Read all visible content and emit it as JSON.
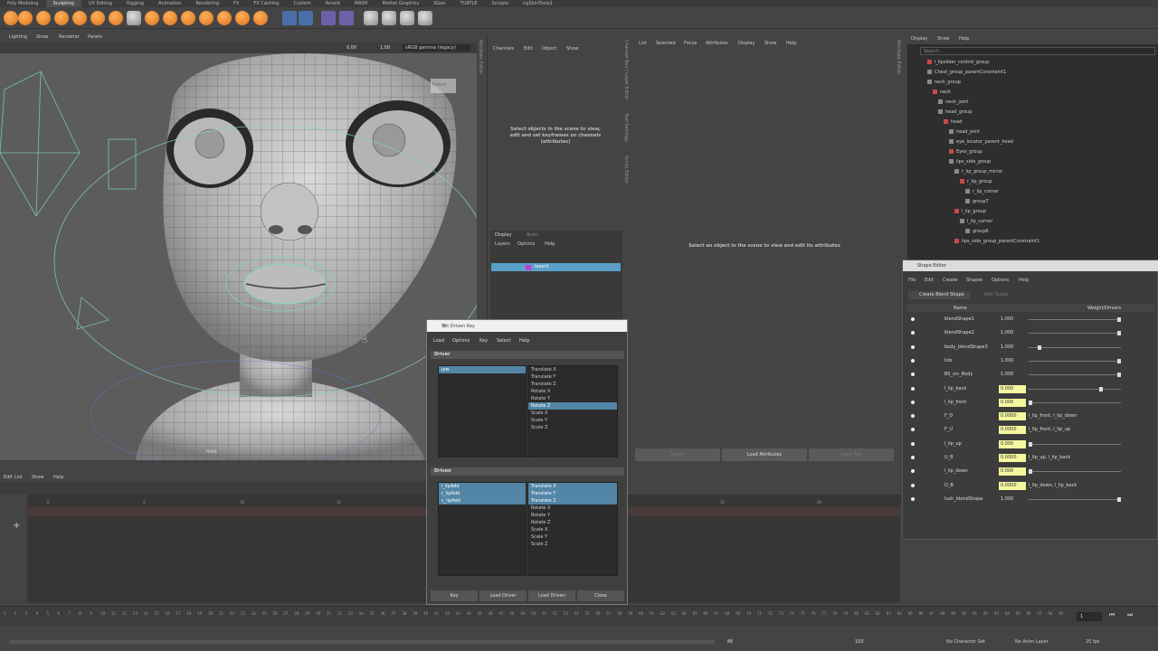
{
  "shelf_tabs": [
    "Poly Modeling",
    "Sculpting",
    "UV Editing",
    "Rigging",
    "Animation",
    "Rendering",
    "FX",
    "FX Caching",
    "Custom",
    "Arnold",
    "MASH",
    "Motion Graphics",
    "XGen",
    "TURTLE",
    "Scrypts",
    "ngSkinTools2"
  ],
  "viewport": {
    "menu": [
      "Lighting",
      "Show",
      "Renderer",
      "Panels"
    ],
    "frame_value": "0.00",
    "scale_value": "1.00",
    "color_space": "sRGB gamma (legacy)",
    "front_label": "front",
    "corner_label": "Femor"
  },
  "channel_box": {
    "menu": [
      "Channels",
      "Edit",
      "Object",
      "Show"
    ],
    "message": "Select objects in the scene to view, edit and set keyframes on channels (attributes)",
    "layer_tabs": [
      "Display",
      "Anim"
    ],
    "layer_menu": [
      "Layers",
      "Options",
      "Help"
    ],
    "layer_name": "layer1",
    "side_labels": [
      "Channel Box / Layer Editor",
      "Tool Settings",
      "Script Editor"
    ]
  },
  "attribute_editor": {
    "menu": [
      "List",
      "Selected",
      "Focus",
      "Attributes",
      "Display",
      "Show",
      "Help"
    ],
    "message": "Select an object in the scene to view and edit its attributes",
    "buttons": [
      "Select",
      "Load Attributes",
      "Copy Tab"
    ],
    "side_label": "Attribute Editor"
  },
  "outliner": {
    "menu": [
      "Display",
      "Show",
      "Help"
    ],
    "search_placeholder": "Search...",
    "items": [
      {
        "label": "l_lipslider_control_group",
        "indent": 2
      },
      {
        "label": "Chest_group_parentConstraint1",
        "indent": 2
      },
      {
        "label": "neck_group",
        "indent": 2
      },
      {
        "label": "neck",
        "indent": 3
      },
      {
        "label": "neck_joint",
        "indent": 4
      },
      {
        "label": "head_group",
        "indent": 4
      },
      {
        "label": "head",
        "indent": 5
      },
      {
        "label": "head_joint",
        "indent": 6
      },
      {
        "label": "eye_locator_parent_head",
        "indent": 6
      },
      {
        "label": "Eyes_group",
        "indent": 6
      },
      {
        "label": "lips_side_group",
        "indent": 6
      },
      {
        "label": "r_lip_group_mirror",
        "indent": 7
      },
      {
        "label": "r_lip_group",
        "indent": 8
      },
      {
        "label": "r_lip_corner",
        "indent": 9
      },
      {
        "label": "group7",
        "indent": 9
      },
      {
        "label": "l_lip_group",
        "indent": 7
      },
      {
        "label": "l_lip_corner",
        "indent": 8
      },
      {
        "label": "group6",
        "indent": 9
      },
      {
        "label": "lips_side_group_parentConstraint1",
        "indent": 7
      }
    ]
  },
  "shape_editor": {
    "title": "Shape Editor",
    "menu": [
      "File",
      "Edit",
      "Create",
      "Shapes",
      "Options",
      "Help"
    ],
    "create_button": "Create Blend Shape",
    "add_target_button": "Add Target",
    "columns": [
      "Name",
      "Weight/Drivers"
    ],
    "rows": [
      {
        "name": "blendShape1",
        "value": "1.000",
        "hl": false,
        "knob": 1.0,
        "drivers": ""
      },
      {
        "name": "blendShape2",
        "value": "1.000",
        "hl": false,
        "knob": 1.0,
        "drivers": ""
      },
      {
        "name": "body_blendShape3",
        "value": "1.000",
        "hl": false,
        "knob": 0.1,
        "drivers": ""
      },
      {
        "name": "lids",
        "value": "1.000",
        "hl": false,
        "knob": 1.0,
        "drivers": ""
      },
      {
        "name": "BS_src_Body",
        "value": "1.000",
        "hl": false,
        "knob": 1.0,
        "drivers": ""
      },
      {
        "name": "l_lip_back",
        "value": "0.000",
        "hl": true,
        "knob": 0.8,
        "drivers": ""
      },
      {
        "name": "l_lip_front",
        "value": "0.000",
        "hl": true,
        "knob": 0.0,
        "drivers": ""
      },
      {
        "name": "F_D",
        "value": "0.0000",
        "hl": true,
        "knob": null,
        "drivers": "l_lip_front, l_lip_down"
      },
      {
        "name": "F_U",
        "value": "0.0000",
        "hl": true,
        "knob": null,
        "drivers": "l_lip_front, l_lip_up"
      },
      {
        "name": "l_lip_up",
        "value": "0.000",
        "hl": true,
        "knob": 0.0,
        "drivers": ""
      },
      {
        "name": "U_B",
        "value": "0.0000",
        "hl": true,
        "knob": null,
        "drivers": "l_lip_up, l_lip_back"
      },
      {
        "name": "l_lip_down",
        "value": "0.000",
        "hl": true,
        "knob": 0.0,
        "drivers": ""
      },
      {
        "name": "D_B",
        "value": "0.0000",
        "hl": true,
        "knob": null,
        "drivers": "l_lip_down, l_lip_back"
      },
      {
        "name": "lush_blendShape",
        "value": "1.000",
        "hl": false,
        "knob": 1.0,
        "drivers": ""
      }
    ]
  },
  "sdk": {
    "title": "Set Driven Key",
    "menu": [
      "Load",
      "Options",
      "Key",
      "Select",
      "Help"
    ],
    "driver_section": "Driver",
    "driven_section": "Driven",
    "driver_objects": [
      "jaw"
    ],
    "driver_attrs": [
      "Translate X",
      "Translate Y",
      "Translate Z",
      "Rotate X",
      "Rotate Y",
      "Rotate Z",
      "Scale X",
      "Scale Y",
      "Scale Z"
    ],
    "driver_attr_selected": 5,
    "driven_objects": [
      "l_lipAdd",
      "r_lipAdd",
      "c_lipAdd"
    ],
    "driven_attrs": [
      "Translate X",
      "Translate Y",
      "Translate Z",
      "Rotate X",
      "Rotate Y",
      "Rotate Z",
      "Scale X",
      "Scale Y",
      "Scale Z"
    ],
    "driven_attr_selected": [
      0,
      1,
      2
    ],
    "buttons": [
      "Key",
      "Load Driver",
      "Load Driven",
      "Close"
    ]
  },
  "graph": {
    "menu": [
      "Edit",
      "List",
      "Show",
      "Help"
    ],
    "ticks": [
      "0",
      "5",
      "10",
      "15",
      "35",
      "40"
    ]
  },
  "time_slider": {
    "ticks": [
      "1",
      "2",
      "3",
      "4",
      "5",
      "6",
      "7",
      "8",
      "9",
      "10",
      "11",
      "12",
      "13",
      "14",
      "15",
      "16",
      "17",
      "18",
      "19",
      "20",
      "21",
      "22",
      "23",
      "24",
      "25",
      "26",
      "27",
      "28",
      "29",
      "30",
      "31",
      "32",
      "33",
      "34",
      "35",
      "36",
      "37",
      "38",
      "39",
      "40",
      "41",
      "42",
      "43",
      "44",
      "45",
      "46",
      "47",
      "48",
      "49",
      "50",
      "51",
      "52",
      "53",
      "54",
      "55",
      "56",
      "57",
      "58",
      "59",
      "60",
      "61",
      "62",
      "63",
      "64",
      "65",
      "66",
      "67",
      "68",
      "69",
      "70",
      "71",
      "72",
      "73",
      "74",
      "75",
      "76",
      "77",
      "78",
      "79",
      "80",
      "81",
      "82",
      "83",
      "84",
      "85",
      "86",
      "87",
      "88",
      "89",
      "90",
      "91",
      "92",
      "93",
      "94",
      "95",
      "96",
      "97",
      "98",
      "99"
    ],
    "current_frame": "1",
    "range_start_value": "86",
    "range_end_value": "100",
    "character_set": "No Character Set",
    "anim_layer": "No Anim Layer",
    "fps": "25 fps"
  }
}
